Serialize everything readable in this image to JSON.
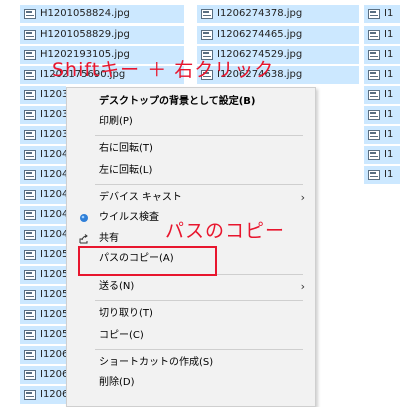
{
  "files": {
    "col1": [
      "H1201058824.jpg",
      "H1201058829.jpg",
      "H1202193105.jpg",
      "I1202175690.jpg",
      "I1203",
      "I1203",
      "I1203",
      "I1204",
      "I1204",
      "I1204",
      "I1204",
      "I1204",
      "I1205",
      "I1205",
      "I1205",
      "I1205",
      "I1205",
      "I1206",
      "I1206",
      "I1206",
      "I1206",
      "I1206"
    ],
    "col2": [
      "I1206274378.jpg",
      "I1206274465.jpg",
      "I1206274529.jpg",
      "I1206274638.jpg"
    ],
    "col3": [
      "I1",
      "I1",
      "I1",
      "I1",
      "I1",
      "I1",
      "I1",
      "I1",
      "I1",
      "I1"
    ]
  },
  "annotations": {
    "shift_right_click": "Shiftキー ＋ 右クリック",
    "copy_as_path": "パスのコピー"
  },
  "menu": {
    "set_background": "デスクトップの背景として設定(B)",
    "print": "印刷(P)",
    "rotate_right": "右に回転(T)",
    "rotate_left": "左に回転(L)",
    "cast_to_device": "デバイス キャスト",
    "virus_scan": "ウイルス検査",
    "share": "共有",
    "copy_as_path": "パスのコピー(A)",
    "send_to": "送る(N)",
    "cut": "切り取り(T)",
    "copy": "コピー(C)",
    "create_shortcut": "ショートカットの作成(S)",
    "delete": "削除(D)"
  },
  "icons": {
    "file": "image-file-icon",
    "submenu": "chevron-right-icon",
    "virus_scan": "shield-icon",
    "share": "share-icon"
  },
  "colors": {
    "selection": "#cce8ff",
    "annotation": "#e8162e",
    "menu_bg": "#f2f2f2"
  }
}
